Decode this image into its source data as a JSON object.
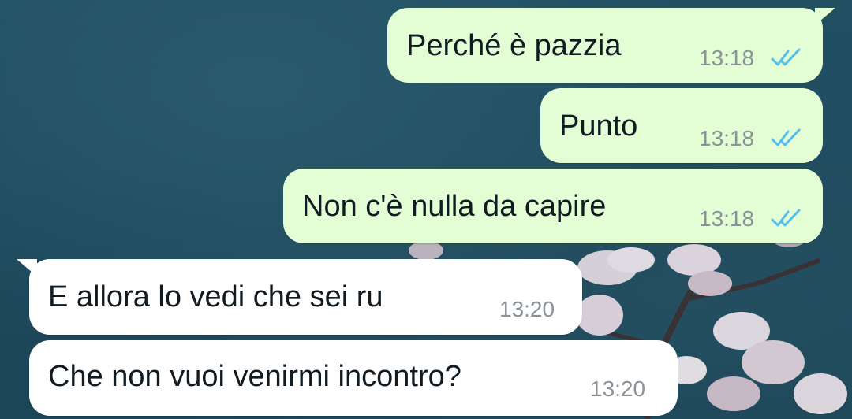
{
  "messages": [
    {
      "direction": "outgoing",
      "text": "Perché è pazzia",
      "time": "13:18",
      "status": "read",
      "status_icon": "double-check-icon"
    },
    {
      "direction": "outgoing",
      "text": "Punto",
      "time": "13:18",
      "status": "read",
      "status_icon": "double-check-icon"
    },
    {
      "direction": "outgoing",
      "text": "Non c'è nulla da capire",
      "time": "13:18",
      "status": "read",
      "status_icon": "double-check-icon"
    },
    {
      "direction": "incoming",
      "text": "E allora lo vedi che sei ru",
      "time": "13:20"
    },
    {
      "direction": "incoming",
      "text": "Che non vuoi venirmi incontro?",
      "time": "13:20"
    }
  ],
  "colors": {
    "outgoing_bubble": "#e3fdd4",
    "incoming_bubble": "#ffffff",
    "read_tick": "#53bdeb",
    "wallpaper": "#1f4a5c"
  }
}
